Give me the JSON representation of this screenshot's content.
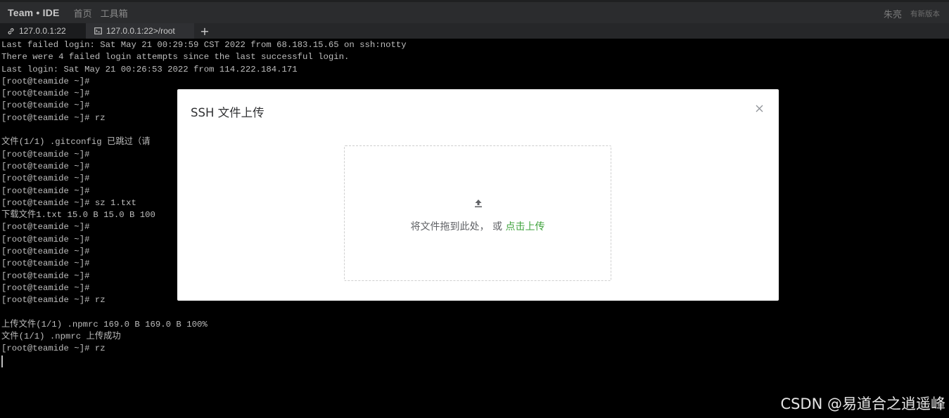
{
  "header": {
    "brand": "Team • IDE",
    "nav": [
      "首页",
      "工具箱"
    ],
    "user_name": "朱亮",
    "new_version": "有新版本"
  },
  "tabs": [
    {
      "label": "127.0.0.1:22",
      "icon": "link-icon",
      "active": true
    },
    {
      "label": "127.0.0.1:22>/root",
      "icon": "folder-icon",
      "active": false
    }
  ],
  "tab_add_label": "+",
  "terminal": {
    "lines": [
      "Last failed login: Sat May 21 00:29:59 CST 2022 from 68.183.15.65 on ssh:notty",
      "There were 4 failed login attempts since the last successful login.",
      "Last login: Sat May 21 00:26:53 2022 from 114.222.184.171",
      "[root@teamide ~]#",
      "[root@teamide ~]#",
      "[root@teamide ~]#",
      "[root@teamide ~]# rz",
      "",
      "文件(1/1) .gitconfig 已跳过（请",
      "[root@teamide ~]#",
      "[root@teamide ~]#",
      "[root@teamide ~]#",
      "[root@teamide ~]#",
      "[root@teamide ~]# sz 1.txt",
      "下载文件1.txt 15.0 B 15.0 B 100",
      "[root@teamide ~]#",
      "[root@teamide ~]#",
      "[root@teamide ~]#",
      "[root@teamide ~]#",
      "[root@teamide ~]#",
      "[root@teamide ~]#",
      "[root@teamide ~]# rz",
      "",
      "上传文件(1/1) .npmrc 169.0 B 169.0 B 100%",
      "文件(1/1) .npmrc 上传成功",
      "[root@teamide ~]# rz"
    ]
  },
  "modal": {
    "title": "SSH 文件上传",
    "drop_text": "将文件拖到此处， 或 ",
    "drop_link": "点击上传"
  },
  "watermark": "CSDN @易道合之逍遥峰",
  "colors": {
    "link_green": "#3fa33c",
    "terminal_bg": "#000000",
    "terminal_fg": "#bdbdbd"
  }
}
